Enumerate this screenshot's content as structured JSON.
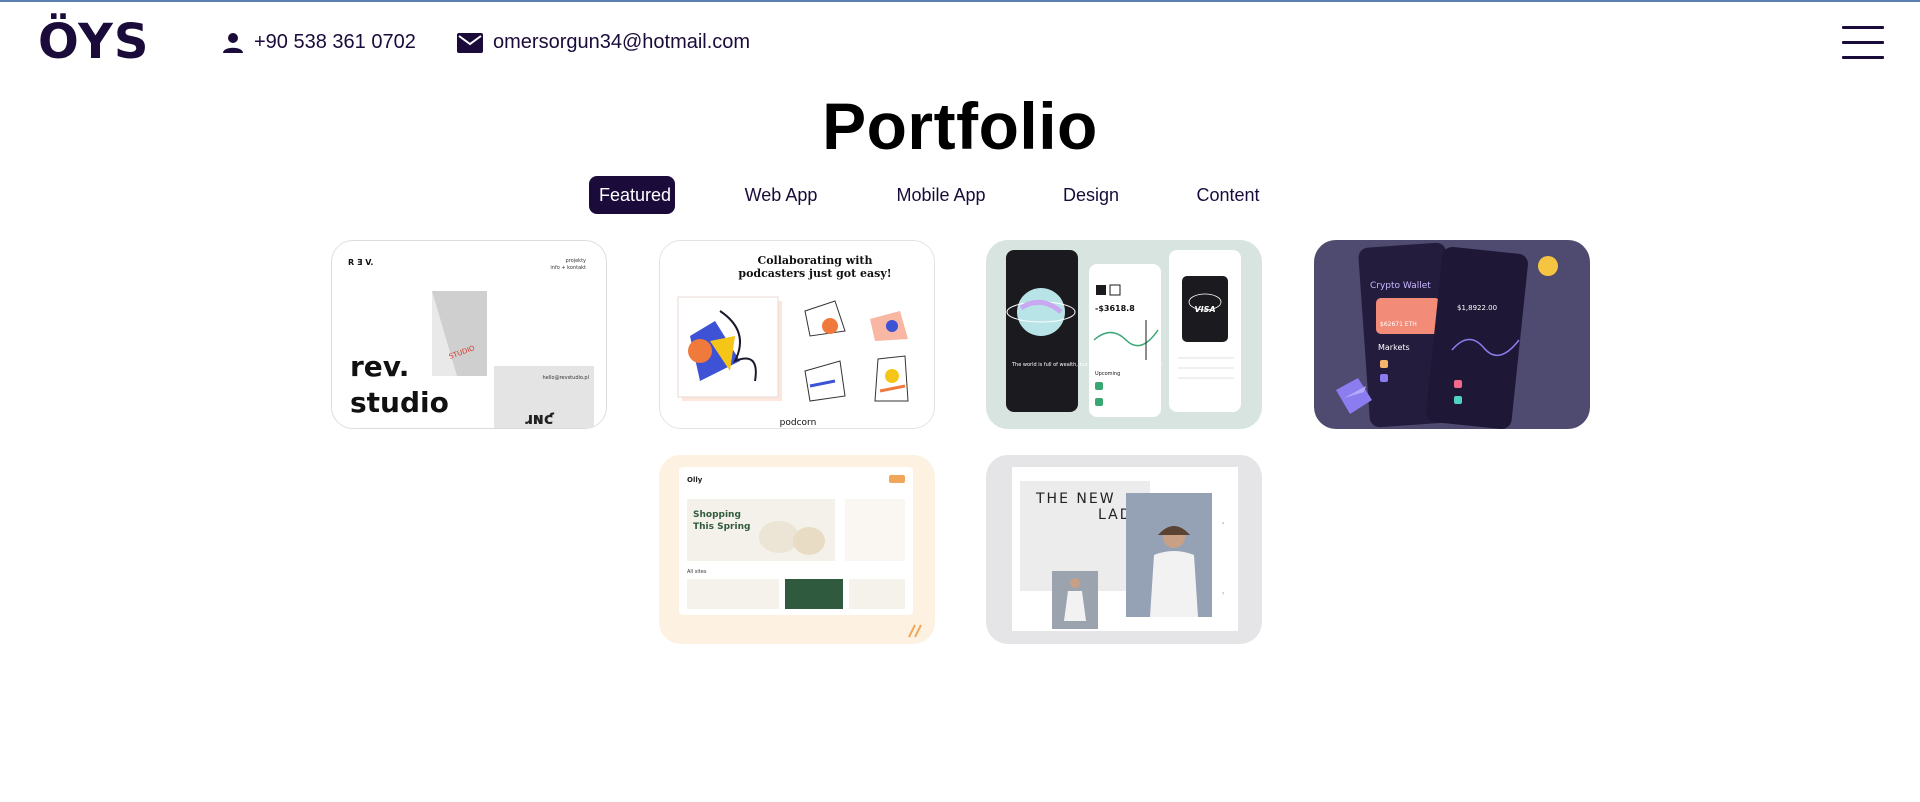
{
  "header": {
    "logo": "ÖYS",
    "phone": "+90 538 361 0702",
    "email": "omersorgun34@hotmail.com"
  },
  "page_title": "Portfolio",
  "tabs": [
    {
      "label": "Featured",
      "active": true
    },
    {
      "label": "Web App",
      "active": false
    },
    {
      "label": "Mobile App",
      "active": false
    },
    {
      "label": "Design",
      "active": false
    },
    {
      "label": "Content",
      "active": false
    }
  ],
  "cards": [
    {
      "name": "rev-studio",
      "texts": {
        "brand": "R Ǝ V.",
        "nav1": "projekty",
        "nav2": "info + kontakt",
        "title1": "rev.",
        "title2": "studio",
        "email": "hello@revstudio.pl",
        "tag": "STUDIO"
      }
    },
    {
      "name": "podcorn",
      "texts": {
        "headline1": "Collaborating with",
        "headline2": "podcasters just got easy!",
        "brand": "podcorn"
      }
    },
    {
      "name": "finance-app",
      "texts": {
        "balance": "-$3618.8",
        "quote": "The world is full of wealth, but it lacks the eyes of discovery.",
        "card": "VISA",
        "section": "Upcoming"
      }
    },
    {
      "name": "crypto-wallet",
      "texts": {
        "title": "Crypto Wallet",
        "amount1": "$62671 ETH",
        "markets": "Markets",
        "amount2": "$1,8922.00"
      }
    },
    {
      "name": "olly-shop",
      "texts": {
        "brand": "Olly",
        "headline1": "Shopping",
        "headline2": "This Spring",
        "section": "All sites"
      }
    },
    {
      "name": "new-lady",
      "texts": {
        "headline1": "THE NEW",
        "headline2": "LADY"
      }
    }
  ],
  "colors": {
    "primary": "#1a0b3a",
    "card_green": "#d7e4df",
    "card_purple": "#4f4a6f",
    "card_peach": "#fdf1e1",
    "card_gray": "#e5e5e8"
  }
}
